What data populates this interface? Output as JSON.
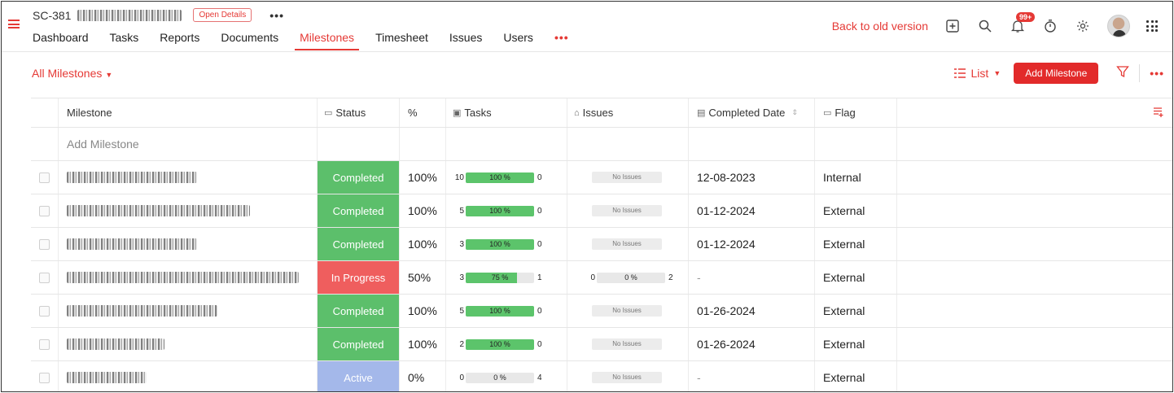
{
  "project": {
    "code": "SC-381",
    "open_details": "Open Details",
    "more": "•••"
  },
  "tabs": [
    {
      "label": "Dashboard"
    },
    {
      "label": "Tasks"
    },
    {
      "label": "Reports"
    },
    {
      "label": "Documents"
    },
    {
      "label": "Milestones",
      "active": true
    },
    {
      "label": "Timesheet"
    },
    {
      "label": "Issues"
    },
    {
      "label": "Users"
    }
  ],
  "tabs_more": "•••",
  "header_right": {
    "back_link": "Back to old version",
    "notification_badge": "99+",
    "icons": [
      "add-icon",
      "search-icon",
      "bell-icon",
      "timer-icon",
      "gear-icon",
      "avatar",
      "app-grid-icon"
    ]
  },
  "toolbar": {
    "filter_label": "All Milestones",
    "view_label": "List",
    "add_button": "Add Milestone",
    "more": "•••"
  },
  "columns": {
    "milestone": "Milestone",
    "status": "Status",
    "percent": "%",
    "tasks": "Tasks",
    "issues": "Issues",
    "completed_date": "Completed Date",
    "flag": "Flag"
  },
  "add_row_placeholder": "Add Milestone",
  "colors": {
    "accent": "#e53935",
    "completed": "#5cbf6b",
    "in_progress": "#ef5e5e",
    "active": "#a4b8ea",
    "bar_fill": "#5cc46b"
  },
  "rows": [
    {
      "status": "Completed",
      "status_key": "completed",
      "percent": "100%",
      "tasks_done": "10",
      "tasks_pct_label": "100 %",
      "tasks_pct": 100,
      "tasks_open": "0",
      "issues": "No Issues",
      "date": "12-08-2023",
      "flag": "Internal"
    },
    {
      "status": "Completed",
      "status_key": "completed",
      "percent": "100%",
      "tasks_done": "5",
      "tasks_pct_label": "100 %",
      "tasks_pct": 100,
      "tasks_open": "0",
      "issues": "No Issues",
      "date": "01-12-2024",
      "flag": "External"
    },
    {
      "status": "Completed",
      "status_key": "completed",
      "percent": "100%",
      "tasks_done": "3",
      "tasks_pct_label": "100 %",
      "tasks_pct": 100,
      "tasks_open": "0",
      "issues": "No Issues",
      "date": "01-12-2024",
      "flag": "External"
    },
    {
      "status": "In Progress",
      "status_key": "progress",
      "percent": "50%",
      "tasks_done": "3",
      "tasks_pct_label": "75 %",
      "tasks_pct": 75,
      "tasks_open": "1",
      "issues_done": "0",
      "issues_pct_label": "0 %",
      "issues_pct": 0,
      "issues_open": "2",
      "date": "-",
      "flag": "External"
    },
    {
      "status": "Completed",
      "status_key": "completed",
      "percent": "100%",
      "tasks_done": "5",
      "tasks_pct_label": "100 %",
      "tasks_pct": 100,
      "tasks_open": "0",
      "issues": "No Issues",
      "date": "01-26-2024",
      "flag": "External"
    },
    {
      "status": "Completed",
      "status_key": "completed",
      "percent": "100%",
      "tasks_done": "2",
      "tasks_pct_label": "100 %",
      "tasks_pct": 100,
      "tasks_open": "0",
      "issues": "No Issues",
      "date": "01-26-2024",
      "flag": "External"
    },
    {
      "status": "Active",
      "status_key": "active",
      "percent": "0%",
      "tasks_done": "0",
      "tasks_pct_label": "0 %",
      "tasks_pct": 0,
      "tasks_open": "4",
      "issues": "No Issues",
      "date": "-",
      "flag": "External"
    }
  ]
}
